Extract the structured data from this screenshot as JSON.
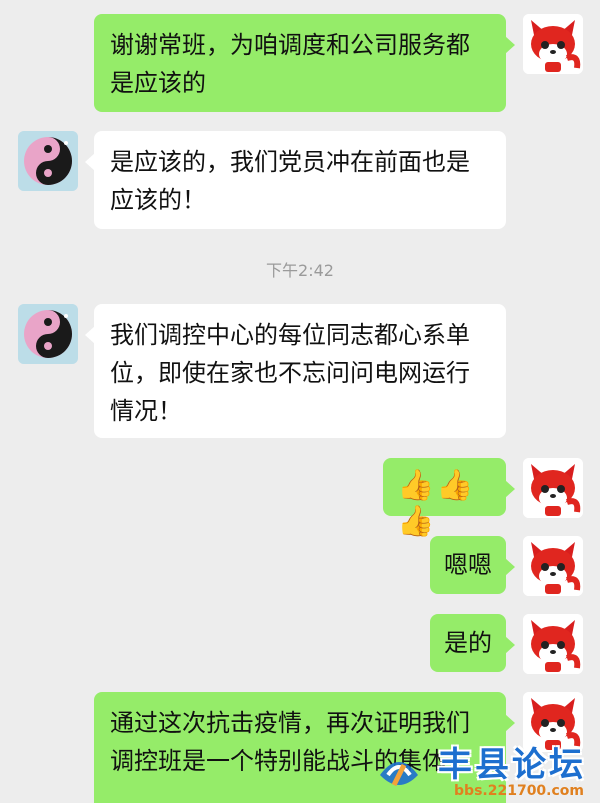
{
  "messages": [
    {
      "id": "m1",
      "sender": "me",
      "text": "谢谢常班，为咱调度和公司服务都是应该的",
      "lines": [
        "谢谢常班，为咱调度和公司服务都",
        "是应该的"
      ]
    },
    {
      "id": "m2",
      "sender": "other",
      "text": "是应该的，我们党员冲在前面也是应该的！",
      "lines": [
        "是应该的，我们党员冲在前面也是",
        "应该的！"
      ]
    },
    {
      "id": "m3",
      "sender": "other",
      "text": "我们调控中心的每位同志都心系单位，即使在家也不忘问问电网运行情况！",
      "lines": [
        "我们调控中心的每位同志都心系单",
        "位，即使在家也不忘问问电网运行",
        "情况！"
      ]
    },
    {
      "id": "m4",
      "sender": "me",
      "text": "👍👍👍"
    },
    {
      "id": "m5",
      "sender": "me",
      "text": "嗯嗯"
    },
    {
      "id": "m6",
      "sender": "me",
      "text": "是的"
    },
    {
      "id": "m7",
      "sender": "me",
      "text": "通过这次抗击疫情，再次证明我们调控班是一个特别能战斗的集体",
      "lines": [
        "通过这次抗击疫情，再次证明我们",
        "调控班是一个特别能战斗的集体"
      ]
    }
  ],
  "timestamp": "下午2:42",
  "watermark": {
    "title": "丰县论坛",
    "url": "bbs.221700.com"
  },
  "colors": {
    "background": "#ededed",
    "my_bubble": "#95ec69",
    "other_bubble": "#ffffff",
    "watermark_blue": "#1d6fcf"
  }
}
